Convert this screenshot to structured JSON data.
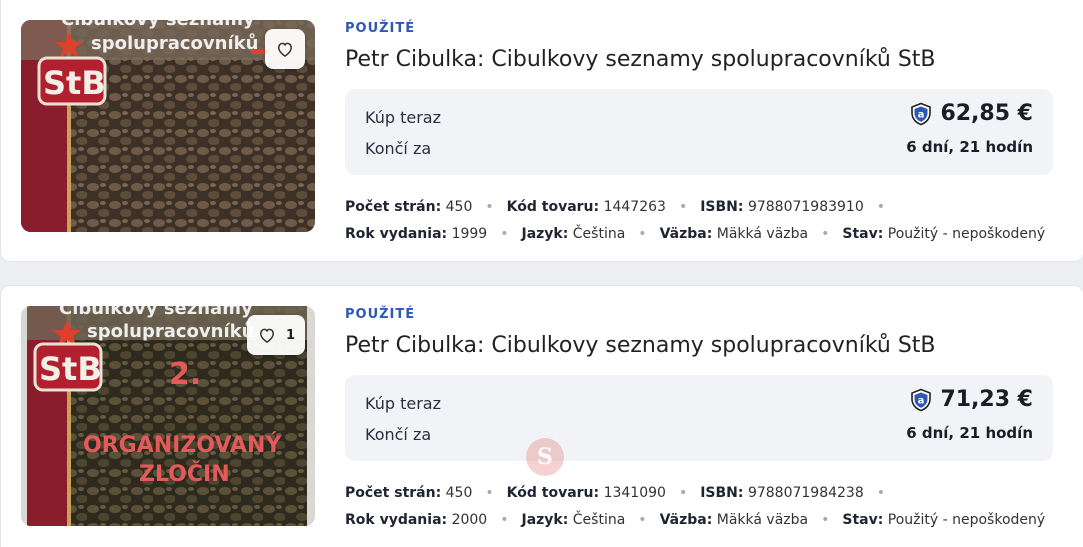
{
  "listings": [
    {
      "condition": "POUŽITÉ",
      "title": "Petr Cibulka: Cibulkovy seznamy spolupracovníků StB",
      "cover": {
        "line1": "Cibulkovy seznamy",
        "line2": "spolupracovníků",
        "badge": "StB",
        "colors": {
          "spine": "#8a1d2c",
          "pattern": "#4a3a2c"
        }
      },
      "favorite_count": "",
      "price_label": "Kúp teraz",
      "price": "62,85 €",
      "ends_label": "Končí za",
      "ends_value": "6 dní, 21 hodín",
      "meta_row1": [
        {
          "k": "Počet strán:",
          "v": "450"
        },
        {
          "k": "Kód tovaru:",
          "v": "1447263"
        },
        {
          "k": "ISBN:",
          "v": "9788071983910"
        }
      ],
      "meta_row2": [
        {
          "k": "Rok vydania:",
          "v": "1999"
        },
        {
          "k": "Jazyk:",
          "v": "Čeština"
        },
        {
          "k": "Väzba:",
          "v": "Mäkká väzba"
        },
        {
          "k": "Stav:",
          "v": "Použitý - nepoškodený"
        }
      ]
    },
    {
      "condition": "POUŽITÉ",
      "title": "Petr Cibulka: Cibulkovy seznamy spolupracovníků StB",
      "cover": {
        "line1": "Cibulkovy seznamy",
        "line2": "spolupracovníků",
        "badge": "StB",
        "volume": "2.",
        "subtitle1": "ORGANIZOVANÝ",
        "subtitle2": "ZLOČIN",
        "colors": {
          "spine": "#8a1d2c",
          "pattern": "#3f3826"
        }
      },
      "favorite_count": "1",
      "price_label": "Kúp teraz",
      "price": "71,23 €",
      "ends_label": "Končí za",
      "ends_value": "6 dní, 21 hodín",
      "meta_row1": [
        {
          "k": "Počet strán:",
          "v": "450"
        },
        {
          "k": "Kód tovaru:",
          "v": "1341090"
        },
        {
          "k": "ISBN:",
          "v": "9788071984238"
        }
      ],
      "meta_row2": [
        {
          "k": "Rok vydania:",
          "v": "2000"
        },
        {
          "k": "Jazyk:",
          "v": "Čeština"
        },
        {
          "k": "Väzba:",
          "v": "Mäkká väzba"
        },
        {
          "k": "Stav:",
          "v": "Použitý - nepoškodený"
        }
      ]
    }
  ],
  "colors": {
    "accent": "#2d58b3",
    "price_box": "#f2f3f6"
  },
  "icons": [
    "heart-icon",
    "shield-a-icon"
  ]
}
